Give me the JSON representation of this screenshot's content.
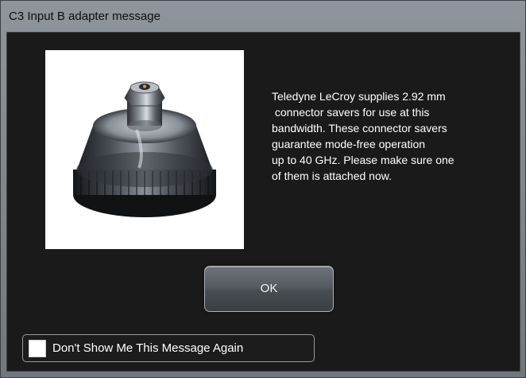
{
  "window": {
    "title": "C3 Input B adapter message"
  },
  "image": {
    "subject": "2.92 mm connector saver",
    "icon": "connector-saver-photo"
  },
  "message": {
    "lines": [
      "Teledyne LeCroy supplies 2.92 mm",
      " connector savers for use at this",
      "bandwidth. These connector savers",
      "guarantee mode-free operation",
      "up to 40 GHz. Please make sure one",
      "of them is attached now."
    ]
  },
  "buttons": {
    "ok_label": "OK"
  },
  "dont_show": {
    "label": "Don't Show Me This Message Again",
    "checked": false
  },
  "colors": {
    "titlebar": "#7f868d",
    "client_bg": "#1a1a1a",
    "text": "#ffffff",
    "button_top": "#6d737a",
    "button_bottom": "#3a3e42"
  }
}
